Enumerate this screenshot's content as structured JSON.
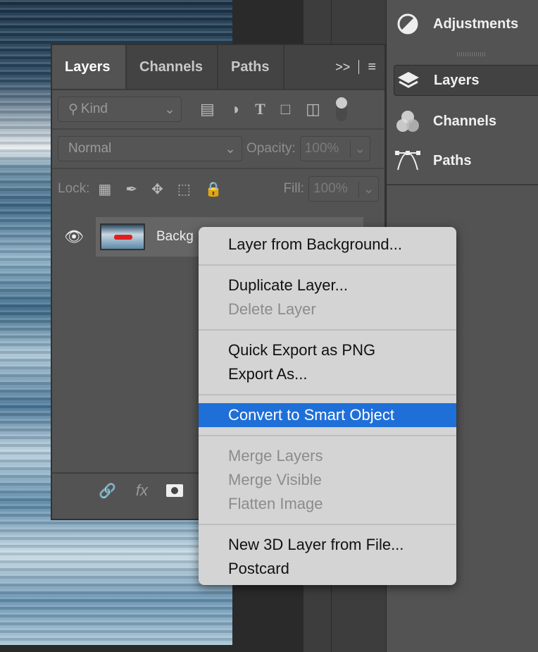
{
  "right_panel": {
    "items": [
      {
        "label": "Adjustments",
        "icon": "adjustments-icon"
      },
      {
        "label": "Layers",
        "icon": "layers-icon",
        "selected": true
      },
      {
        "label": "Channels",
        "icon": "channels-icon"
      },
      {
        "label": "Paths",
        "icon": "paths-icon"
      }
    ]
  },
  "layers_panel": {
    "tabs": [
      "Layers",
      "Channels",
      "Paths"
    ],
    "filter": {
      "value": "Kind"
    },
    "blend_mode": "Normal",
    "opacity_label": "Opacity:",
    "opacity": "100%",
    "lock_label": "Lock:",
    "fill_label": "Fill:",
    "fill": "100%",
    "layer": {
      "name": "Backg",
      "visible": true
    },
    "footer": {
      "fx": "fx"
    }
  },
  "context_menu": {
    "groups": [
      [
        {
          "label": "Layer from Background...",
          "enabled": true
        }
      ],
      [
        {
          "label": "Duplicate Layer...",
          "enabled": true
        },
        {
          "label": "Delete Layer",
          "enabled": false
        }
      ],
      [
        {
          "label": "Quick Export as PNG",
          "enabled": true
        },
        {
          "label": "Export As...",
          "enabled": true
        }
      ],
      [
        {
          "label": "Convert to Smart Object",
          "enabled": true,
          "highlighted": true
        }
      ],
      [
        {
          "label": "Merge Layers",
          "enabled": false
        },
        {
          "label": "Merge Visible",
          "enabled": false
        },
        {
          "label": "Flatten Image",
          "enabled": false
        }
      ],
      [
        {
          "label": "New 3D Layer from File...",
          "enabled": true
        },
        {
          "label": "Postcard",
          "enabled": true
        }
      ]
    ]
  },
  "colors": {
    "highlight": "#1f6fd8",
    "panel": "#535353"
  }
}
